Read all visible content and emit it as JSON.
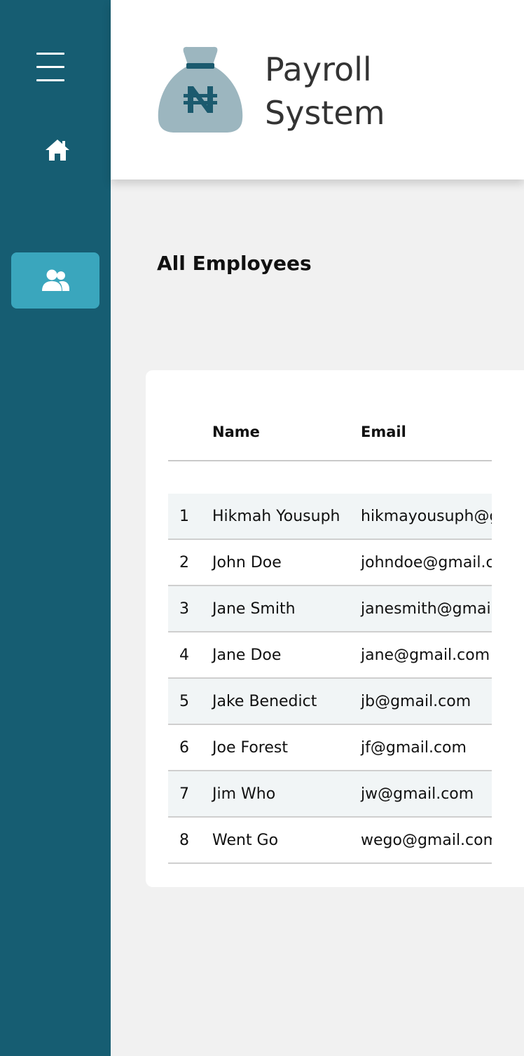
{
  "sidebar": {
    "menu_icon": "hamburger-menu-icon",
    "home_icon": "home-icon",
    "employees_icon": "users-icon",
    "active_color": "#3aa6bd",
    "background_color": "#165d72"
  },
  "header": {
    "logo_icon": "money-bag-naira-icon",
    "title_line1": "Payroll",
    "title_line2": "System"
  },
  "main": {
    "page_title": "All Employees",
    "table": {
      "columns": [
        "",
        "Name",
        "Email"
      ],
      "rows": [
        {
          "no": "1",
          "name": "Hikmah Yousuph",
          "email": "hikmayousuph@gmail.com"
        },
        {
          "no": "2",
          "name": "John Doe",
          "email": "johndoe@gmail.com"
        },
        {
          "no": "3",
          "name": "Jane Smith",
          "email": "janesmith@gmail.com"
        },
        {
          "no": "4",
          "name": "Jane Doe",
          "email": "jane@gmail.com"
        },
        {
          "no": "5",
          "name": "Jake Benedict",
          "email": "jb@gmail.com"
        },
        {
          "no": "6",
          "name": "Joe Forest",
          "email": "jf@gmail.com"
        },
        {
          "no": "7",
          "name": "Jim Who",
          "email": "jw@gmail.com"
        },
        {
          "no": "8",
          "name": "Went Go",
          "email": "wego@gmail.com"
        }
      ]
    }
  }
}
